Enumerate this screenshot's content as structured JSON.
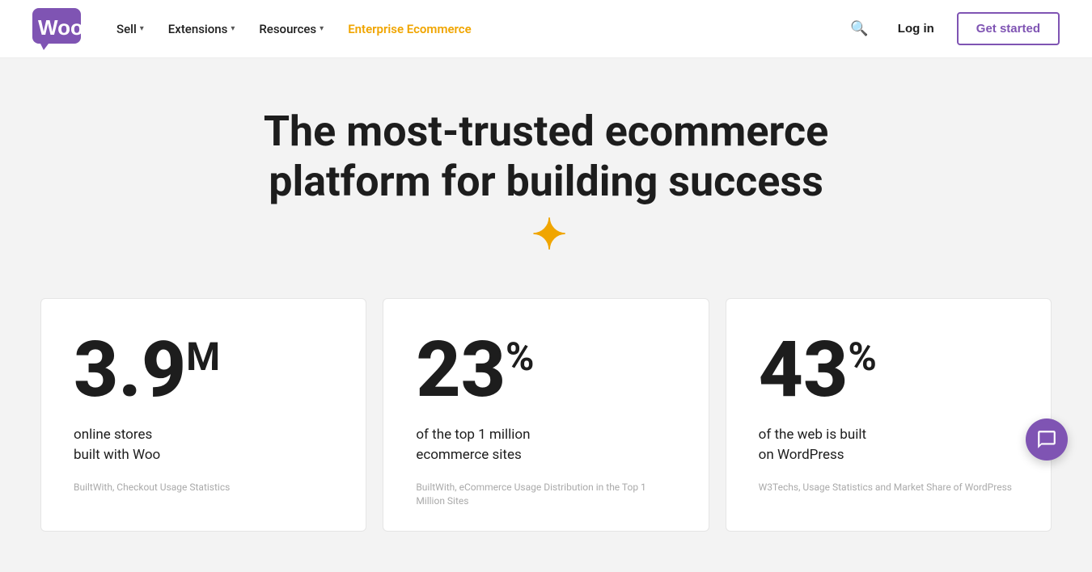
{
  "navbar": {
    "logo_text": "Woo",
    "nav_items": [
      {
        "label": "Sell",
        "has_dropdown": true
      },
      {
        "label": "Extensions",
        "has_dropdown": true
      },
      {
        "label": "Resources",
        "has_dropdown": true
      },
      {
        "label": "Enterprise Ecommerce",
        "has_dropdown": false,
        "highlight": true
      }
    ],
    "login_label": "Log in",
    "get_started_label": "Get started"
  },
  "hero": {
    "title_line1": "The most-trusted ecommerce",
    "title_line2": "platform for building success",
    "sparkle": "✦"
  },
  "stats": [
    {
      "main": "3.9",
      "suffix": "M",
      "description": "online stores\nbuilt with Woo",
      "source": "BuiltWith, Checkout Usage Statistics"
    },
    {
      "main": "23",
      "suffix": "%",
      "description": "of the top 1 million\necommerce sites",
      "source": "BuiltWith, eCommerce Usage Distribution in the Top 1 Million Sites"
    },
    {
      "main": "43",
      "suffix": "%",
      "description": "of the web is built\non WordPress",
      "source": "W3Techs, Usage Statistics and Market Share of WordPress"
    }
  ]
}
